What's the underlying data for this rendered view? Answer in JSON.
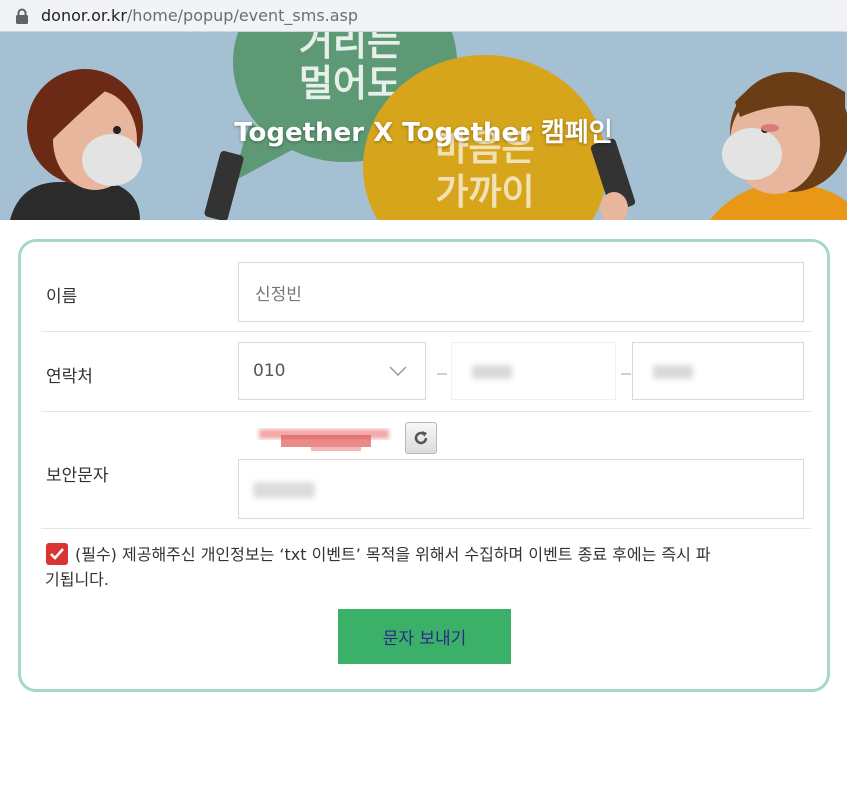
{
  "browser": {
    "url_host": "donor.or.kr",
    "url_path": "/home/popup/event_sms.asp",
    "icons": {
      "lock": "lock-icon"
    }
  },
  "banner": {
    "title": "Together X Together 캠페인",
    "bubble_left_text": [
      "거리는",
      "멀어도"
    ],
    "bubble_right_text": [
      "마음은",
      "가까이"
    ]
  },
  "form": {
    "name_label": "이름",
    "name_value": "신정빈",
    "phone_label": "연락처",
    "phone_prefix": "010",
    "captcha_label": "보안문자",
    "consent_text_line1": "(필수) 제공해주신 개인정보는 ‘txt 이벤트’ 목적을 위해서 수집하며 이벤트 종료 후에는 즉시 파",
    "consent_text_line2": "기됩니다.",
    "consent_checked": true,
    "submit_label": "문자 보내기"
  },
  "colors": {
    "banner_bg": "#a4c0d2",
    "form_border": "#a7d7cc",
    "submit_bg": "#3bb068",
    "checkbox": "#d93434"
  }
}
